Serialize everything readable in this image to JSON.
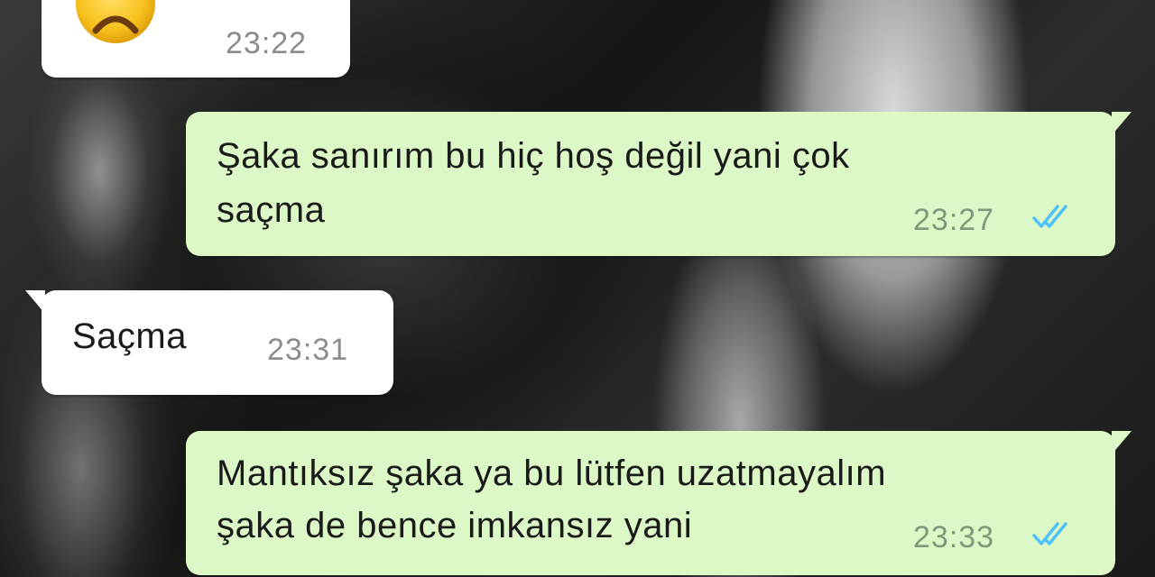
{
  "messages": [
    {
      "direction": "incoming",
      "emoji": "frowning-face-emoji",
      "time": "23:22"
    },
    {
      "direction": "outgoing",
      "line1": "Şaka sanırım bu hiç hoş değil yani çok",
      "line2": "saçma",
      "time": "23:27",
      "status": "read-double-check"
    },
    {
      "direction": "incoming",
      "line1": "Saçma",
      "time": "23:31"
    },
    {
      "direction": "outgoing",
      "line1": "Mantıksız şaka ya bu lütfen uzatmayalım",
      "line2": "şaka de bence imkansız yani",
      "time": "23:33",
      "status": "read-double-check"
    }
  ],
  "colors": {
    "incoming_bubble": "#ffffff",
    "outgoing_bubble": "#dcf8c6",
    "read_ticks": "#4fc3f7",
    "emoji_face": "#f7c21e"
  }
}
